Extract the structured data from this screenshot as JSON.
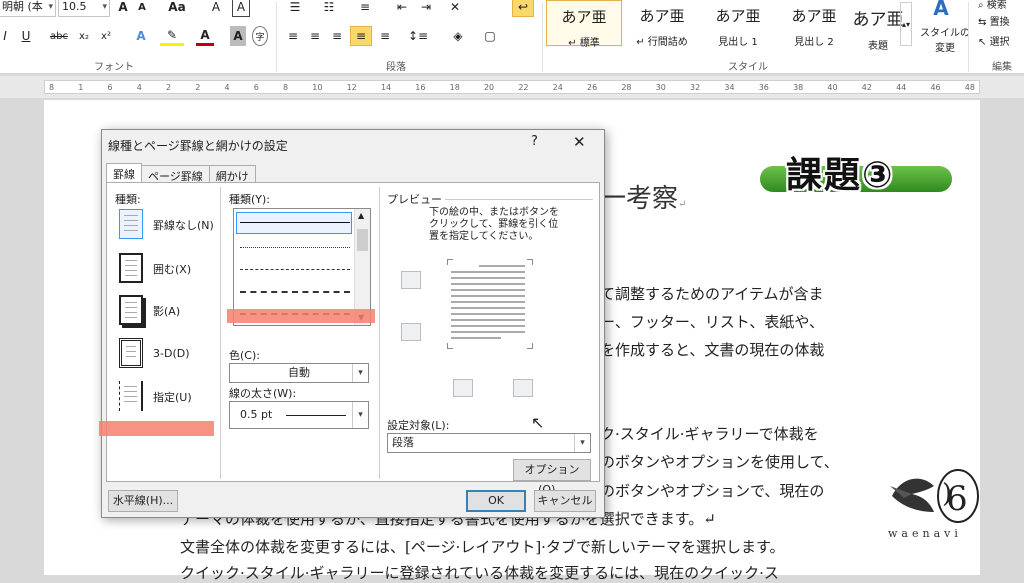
{
  "ribbon": {
    "font_name": "明朝 (本",
    "font_size": "10.5",
    "font_buttons": {
      "grow": "A",
      "shrink": "A",
      "case": "Aa",
      "clear": "A",
      "bold_a": "A"
    },
    "format_buttons": {
      "italic": "I",
      "underline": "U",
      "strike": "abc",
      "sub": "x₂",
      "sup": "x²"
    },
    "group_font": "フォント",
    "group_paragraph": "段落",
    "group_styles": "スタイル",
    "group_edit": "編集",
    "styles": [
      {
        "sample": "あア亜",
        "name": "↵ 標準"
      },
      {
        "sample": "あア亜",
        "name": "↵ 行間詰め"
      },
      {
        "sample": "あア亜",
        "name": "見出し 1"
      },
      {
        "sample": "あア亜",
        "name": "見出し 2"
      },
      {
        "sample": "あア亜",
        "name": "表題"
      }
    ],
    "change_styles": "スタイルの\n変更",
    "edit_items": [
      "検索",
      "置換",
      "選択"
    ]
  },
  "ruler_marks": [
    "8",
    "1",
    "6",
    "4",
    "2",
    "2",
    "4",
    "6",
    "8",
    "10",
    "12",
    "14",
    "16",
    "18",
    "20",
    "22",
    "24",
    "26",
    "28",
    "30",
    "32",
    "34",
    "36",
    "38",
    "40",
    "42",
    "44",
    "46",
    "48"
  ],
  "document": {
    "title_fragment": "一考察",
    "lines": [
      "て調整するためのアイテムが含ま",
      "ー、フッター、リスト、表紙や、",
      "を作成すると、文書の現在の体裁",
      "ク·スタイル·ギャラリーで体裁を",
      "のボタンやオプションを使用して、",
      "のボタンやオプションで、現在の",
      "テーマの体裁を使用するか、直接指定する書式を使用するかを選択できます。↵",
      "文書全体の体裁を変更するには、[ページ·レイアウト]·タブで新しいテーマを選択します。",
      "クイック·スタイル·ギャラリーに登録されている体裁を変更するには、現在のクイック·ス"
    ],
    "badge": "課題③",
    "logo_text": "waenavi"
  },
  "dialog": {
    "title": "線種とページ罫線と網かけの設定",
    "help": "?",
    "close": "✕",
    "tabs": [
      "罫線",
      "ページ罫線",
      "網かけ"
    ],
    "kind_label": "種類:",
    "kinds": [
      "罫線なし(N)",
      "囲む(X)",
      "影(A)",
      "3-D(D)",
      "指定(U)"
    ],
    "line_type_label": "種類(Y):",
    "color_label": "色(C):",
    "color_value": "自動",
    "width_label": "線の太さ(W):",
    "width_value": "0.5 pt",
    "preview_label": "プレビュー",
    "preview_hint": "下の絵の中、またはボタンを\nクリックして、罫線を引く位\n置を指定してください。",
    "apply_label": "設定対象(L):",
    "apply_value": "段落",
    "options_button": "オプション(O)...",
    "horizontal_button": "水平線(H)...",
    "ok_button": "OK",
    "cancel_button": "キャンセル"
  },
  "colors": {
    "highlight": "#f4806f",
    "badge_green": "#3fa12b",
    "selection": "#3399ff"
  }
}
